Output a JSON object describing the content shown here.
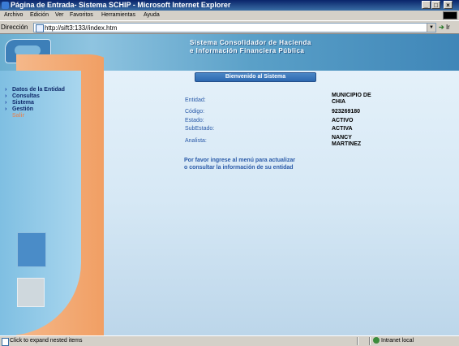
{
  "window": {
    "title": "Página de Entrada- Sistema SCHIP - Microsoft Internet Explorer"
  },
  "menu": [
    "Archivo",
    "Edición",
    "Ver",
    "Favoritos",
    "Herramientas",
    "Ayuda"
  ],
  "address": {
    "label": "Dirección",
    "url": "http://sift3:133//index.htm",
    "go_label": "Ir"
  },
  "banner": {
    "line1": "Sistema Consolidador de Hacienda",
    "line2": "e Información Financiera Pública"
  },
  "nav": [
    "Datos de la Entidad",
    "Consultas",
    "Sistema",
    "Gestión",
    "Salir"
  ],
  "welcome": "Bienvenido al Sistema",
  "fields": [
    {
      "label": "Entidad:",
      "value": "MUNICIPIO DE CHIA"
    },
    {
      "label": "Código:",
      "value": "923269180"
    },
    {
      "label": "Estado:",
      "value": "ACTIVO"
    },
    {
      "label": "SubEstado:",
      "value": "ACTIVA"
    },
    {
      "label": "Analista:",
      "value": "NANCY MARTINEZ"
    }
  ],
  "message": {
    "line1": "Por favor ingrese al menú para actualizar",
    "line2": "o consultar la información de su entidad"
  },
  "status": {
    "text": "Click to expand nested items",
    "zone": "Intranet local"
  }
}
